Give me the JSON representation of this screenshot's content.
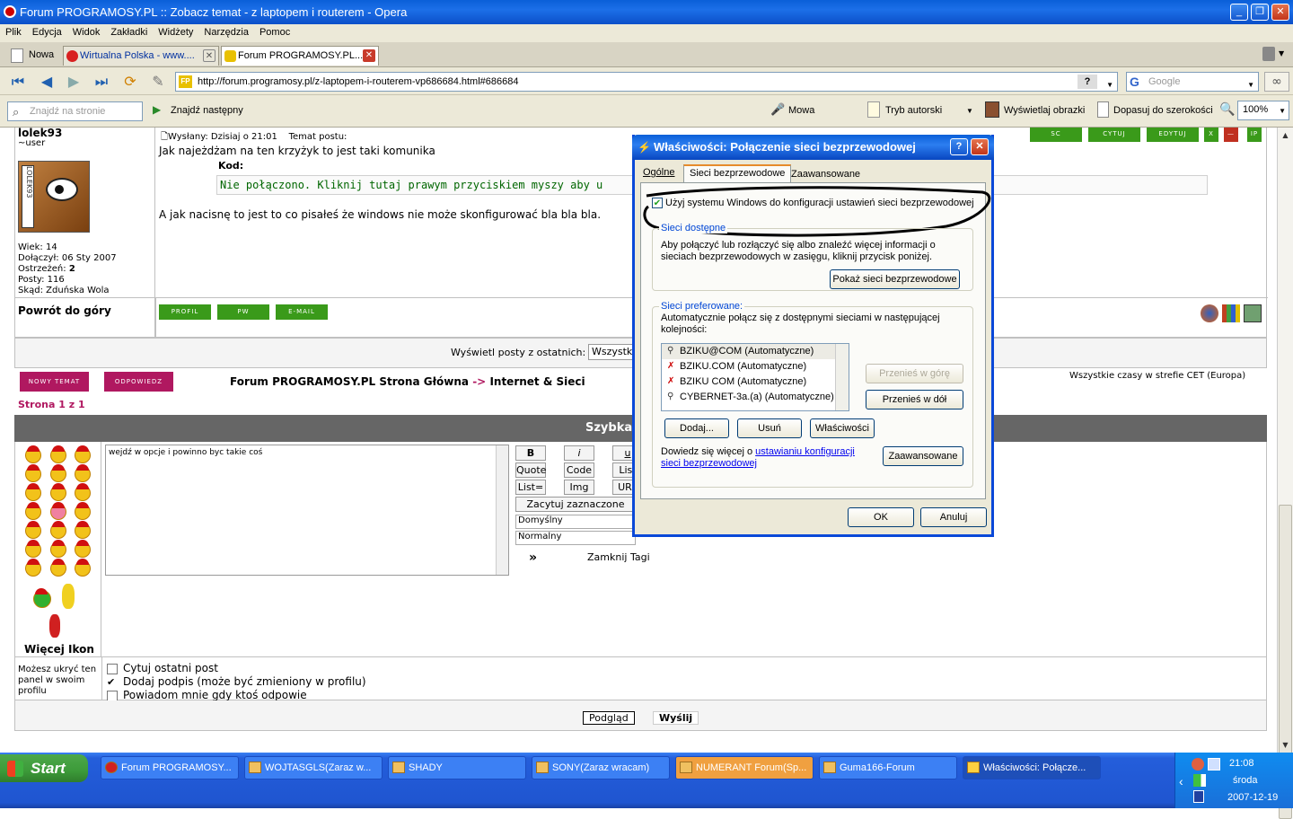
{
  "window": {
    "title": "Forum PROGRAMOSY.PL :: Zobacz temat - z laptopem i routerem - Opera"
  },
  "menu": [
    "Plik",
    "Edycja",
    "Widok",
    "Zakładki",
    "Widżety",
    "Narzędzia",
    "Pomoc"
  ],
  "tabs": {
    "new_label": "Nowa",
    "items": [
      {
        "label": "Wirtualna Polska - www...."
      },
      {
        "label": "Forum PROGRAMOSY.PL..."
      }
    ]
  },
  "address": {
    "url": "http://forum.programosy.pl/z-laptopem-i-routerem-vp686684.html#686684",
    "fav": "FP",
    "help": "?"
  },
  "search": {
    "placeholder": "Google"
  },
  "findbar": {
    "placeholder": "Znajdź na stronie",
    "find_next": "Znajdź następny",
    "voice": "Mowa",
    "author_mode": "Tryb autorski",
    "show_images": "Wyświetlaj obrazki",
    "fit_width": "Dopasuj do szerokości",
    "zoom": "100%"
  },
  "post": {
    "author": "lolek93",
    "rank": "~user",
    "posted": "Wysłany: Dzisiaj o 21:01",
    "subject": "Temat postu:",
    "text1": "Jak najeżdżam na ten krzyżyk to jest taki komunika",
    "code_label": "Kod:",
    "code": "Nie połączono. Kliknij tutaj prawym przyciskiem myszy aby u",
    "text2": "A jak nacisnę to jest to co pisałeś że windows nie może skonfigurować bla bla bla.",
    "stats": {
      "age_label": "Wiek:",
      "age": "14",
      "joined_label": "Dołączył:",
      "joined": "06 Sty 2007",
      "warn_label": "Ostrzeżeń:",
      "warn": "2",
      "posts_label": "Posty:",
      "posts": "116",
      "from_label": "Skąd:",
      "from": "Zduńska Wola"
    },
    "top_buttons": [
      "SC",
      "CYTUJ",
      "EDYTUJ",
      "X",
      "—",
      "IP"
    ],
    "back_to_top": "Powrót do góry",
    "profile_buttons": [
      "PROFIL",
      "PW",
      "E-MAIL"
    ]
  },
  "forum": {
    "show_posts_label": "Wyświetl posty z ostatnich:",
    "show_posts_value": "Wszystk",
    "new_topic": "NOWY TEMAT",
    "reply": "ODPOWIEDZ",
    "breadcrumb_home": "Forum PROGRAMOSY.PL Strona Główna",
    "breadcrumb_sep": "->",
    "breadcrumb_section": "Internet & Sieci",
    "timezone": "Wszystkie czasy w strefie CET (Europa)",
    "page": "Strona 1 z 1",
    "quick_reply_title": "Szybka",
    "reply_text": "wejdź w opcje i powinno byc takie coś",
    "more_icons": "Więcej Ikon",
    "format_buttons": [
      "B",
      "i",
      "u",
      "Quote",
      "Code",
      "List",
      "List=",
      "Img",
      "URL"
    ],
    "quote_selected": "Zacytuj zaznaczone",
    "font_default": "Domyślny",
    "font_size": "Normalny",
    "expand": "»",
    "close_tags": "Zamknij Tagi",
    "hide_panel": "Możesz ukryć ten panel w swoim profilu",
    "options": [
      {
        "label": "Cytuj ostatni post",
        "checked": false
      },
      {
        "label": "Dodaj podpis (może być zmieniony w profilu)",
        "checked": true
      },
      {
        "label": "Powiadom mnie gdy ktoś odpowie",
        "checked": false
      }
    ],
    "preview": "Podgląd",
    "send": "Wyślij"
  },
  "dialog": {
    "title": "Właściwości: Połączenie sieci bezprzewodowej",
    "tabs": [
      "Ogólne",
      "Sieci bezprzewodowe",
      "Zaawansowane"
    ],
    "use_windows": "Użyj systemu Windows do konfiguracji ustawień sieci bezprzewodowej",
    "available_label": "Sieci dostępne",
    "available_text": "Aby połączyć lub rozłączyć się albo znaleźć więcej informacji o sieciach bezprzewodowych w zasięgu, kliknij przycisk poniżej.",
    "show_networks": "Pokaż sieci bezprzewodowe",
    "preferred_label": "Sieci preferowane:",
    "preferred_text": "Automatycznie połącz się z dostępnymi sieciami w następującej kolejności:",
    "networks": [
      "BZIKU@COM (Automatyczne)",
      "BZIKU.COM (Automatyczne)",
      "BZIKU COM (Automatyczne)",
      "CYBERNET-3a.(a) (Automatyczne)"
    ],
    "move_up": "Przenieś w górę",
    "move_down": "Przenieś w dół",
    "add": "Dodaj...",
    "remove": "Usuń",
    "properties": "Właściwości",
    "learn_prefix": "Dowiedz się więcej o",
    "learn_link": "ustawianiu konfiguracji sieci bezprzewodowej",
    "advanced": "Zaawansowane",
    "ok": "OK",
    "cancel": "Anuluj"
  },
  "taskbar": {
    "start": "Start",
    "tasks": [
      {
        "label": "Forum PROGRAMOSY..."
      },
      {
        "label": "WOJTASGLS(Zaraz w..."
      },
      {
        "label": "SHADY"
      },
      {
        "label": "SONY(Zaraz wracam)"
      },
      {
        "label": "NUMERANT Forum(Sp..."
      },
      {
        "label": "Guma166-Forum"
      },
      {
        "label": "Właściwości: Połącze..."
      }
    ],
    "time": "21:08",
    "day": "środa",
    "date": "2007-12-19"
  }
}
